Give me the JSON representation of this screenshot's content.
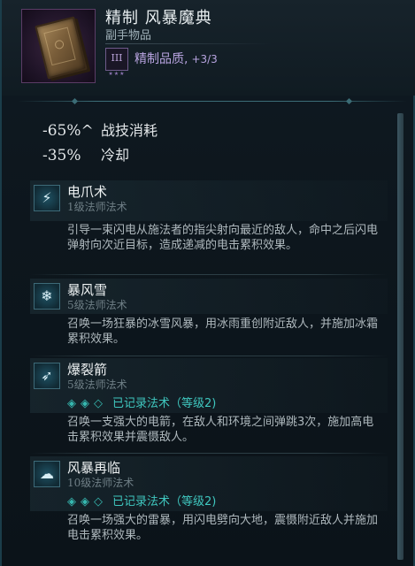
{
  "item": {
    "name": "精制 风暴魔典",
    "type": "副手物品",
    "quality_tier": "III",
    "quality_stars": "★★★",
    "quality_label": "精制品质,",
    "quality_value": "+3/3"
  },
  "stats": [
    {
      "value": "-65%^",
      "label": "战技消耗"
    },
    {
      "value": "-35%",
      "label": "冷却"
    }
  ],
  "skills": [
    {
      "icon": "lightning-claw-icon",
      "glyph": "⚡",
      "name": "电爪术",
      "level": "1级法师法术",
      "record": "",
      "description": "引导一束闪电从施法者的指尖射向最近的敌人，命中之后闪电弹射向次近目标，造成递减的电击累积效果。"
    },
    {
      "icon": "blizzard-icon",
      "glyph": "❄",
      "name": "暴风雪",
      "level": "5级法师法术",
      "record": "",
      "description": "召唤一场狂暴的冰雪风暴，用冰雨重创附近敌人，并施加冰霜累积效果。"
    },
    {
      "icon": "burst-arrow-icon",
      "glyph": "➶",
      "name": "爆裂箭",
      "level": "5级法师法术",
      "record_gems": "◈◈◇",
      "record": "已记录法术（等级2)",
      "description": "召唤一支强大的电箭，在敌人和环境之间弹跳3次，施加高电击累积效果并震慑敌人。"
    },
    {
      "icon": "storm-cloud-icon",
      "glyph": "☁",
      "name": "风暴再临",
      "level": "10级法师法术",
      "record_gems": "◈◈◇",
      "record": "已记录法术（等级2)",
      "description": "召唤一场强大的雷暴，用闪电劈向大地，震慑附近敌人并施加电击累积效果。"
    }
  ],
  "colors": {
    "quality_purple": "#b8a4e0",
    "record_teal": "#3fc7bf",
    "frame_border": "#1b3d4a"
  }
}
